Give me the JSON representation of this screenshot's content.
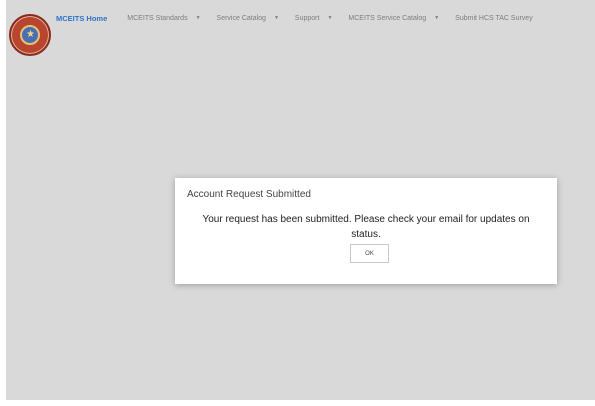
{
  "header": {
    "logo_icon": "seal-emblem-icon",
    "nav": [
      {
        "label": "MCEITS Home",
        "active": true,
        "has_dropdown": false
      },
      {
        "label": "MCEITS Standards",
        "active": false,
        "has_dropdown": true
      },
      {
        "label": "Service Catalog",
        "active": false,
        "has_dropdown": true
      },
      {
        "label": "Support",
        "active": false,
        "has_dropdown": true
      },
      {
        "label": "MCEITS Service Catalog",
        "active": false,
        "has_dropdown": true
      },
      {
        "label": "Submit HCS TAC Survey",
        "active": false,
        "has_dropdown": false
      }
    ],
    "dropdown_caret_glyph": "▼",
    "active_color": "#2e73c9"
  },
  "dialog": {
    "title": "Account Request Submitted",
    "message": "Your request has been submitted. Please check your email for updates on status.",
    "ok_label": "OK"
  },
  "colors": {
    "page_background": "#d9d9d9",
    "dialog_background": "#ffffff"
  }
}
